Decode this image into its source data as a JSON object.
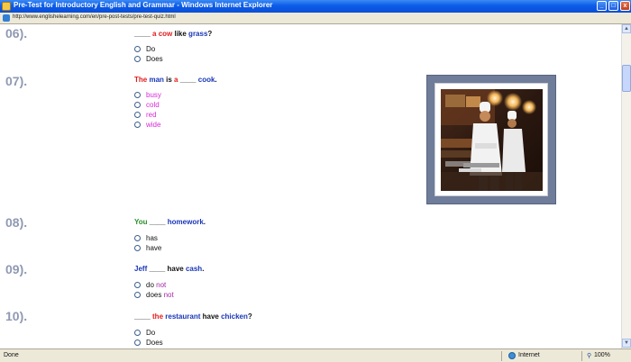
{
  "window": {
    "title": "Pre-Test for Introductory English and Grammar - Windows Internet Explorer",
    "minimize": "_",
    "maximize": "□",
    "close": "x"
  },
  "address": {
    "url": "http://www.englishelearning.com/en/pre-post-tests/pre-test-quiz.html"
  },
  "questions": [
    {
      "number": "06).",
      "parts": [
        {
          "text": "____",
          "color": "blk"
        },
        {
          "text": " a cow",
          "color": "red"
        },
        {
          "text": " like",
          "color": "blk"
        },
        {
          "text": " grass",
          "color": "blu"
        },
        {
          "text": "?",
          "color": "blk"
        }
      ],
      "options": [
        {
          "parts": [
            {
              "text": "Do",
              "color": "blk"
            }
          ]
        },
        {
          "parts": [
            {
              "text": "Does",
              "color": "blk"
            }
          ]
        }
      ]
    },
    {
      "number": "07).",
      "parts": [
        {
          "text": "The",
          "color": "red"
        },
        {
          "text": " man",
          "color": "blu"
        },
        {
          "text": " is",
          "color": "blk"
        },
        {
          "text": " a",
          "color": "red"
        },
        {
          "text": " ____",
          "color": "blk"
        },
        {
          "text": " cook",
          "color": "blu"
        },
        {
          "text": ".",
          "color": "blk"
        }
      ],
      "options": [
        {
          "parts": [
            {
              "text": "busy",
              "color": "mag"
            }
          ]
        },
        {
          "parts": [
            {
              "text": "cold",
              "color": "mag"
            }
          ]
        },
        {
          "parts": [
            {
              "text": "red",
              "color": "mag"
            }
          ]
        },
        {
          "parts": [
            {
              "text": "wide",
              "color": "mag"
            }
          ]
        }
      ]
    },
    {
      "number": "08).",
      "parts": [
        {
          "text": "You",
          "color": "grn"
        },
        {
          "text": " ____",
          "color": "blk"
        },
        {
          "text": " homework",
          "color": "blu"
        },
        {
          "text": ".",
          "color": "blk"
        }
      ],
      "options": [
        {
          "parts": [
            {
              "text": "has",
              "color": "blk"
            }
          ]
        },
        {
          "parts": [
            {
              "text": "have",
              "color": "blk"
            }
          ]
        }
      ]
    },
    {
      "number": "09).",
      "parts": [
        {
          "text": "Jeff",
          "color": "blu"
        },
        {
          "text": " ____ have",
          "color": "blk"
        },
        {
          "text": " cash",
          "color": "blu"
        },
        {
          "text": ".",
          "color": "blk"
        }
      ],
      "options": [
        {
          "parts": [
            {
              "text": "do",
              "color": "blk"
            },
            {
              "text": " not",
              "color": "pur"
            }
          ]
        },
        {
          "parts": [
            {
              "text": "does",
              "color": "blk"
            },
            {
              "text": " not",
              "color": "pur"
            }
          ]
        }
      ]
    },
    {
      "number": "10).",
      "parts": [
        {
          "text": "____",
          "color": "blk"
        },
        {
          "text": " the",
          "color": "red"
        },
        {
          "text": " restaurant",
          "color": "blu"
        },
        {
          "text": " have",
          "color": "blk"
        },
        {
          "text": " chicken",
          "color": "blu"
        },
        {
          "text": "?",
          "color": "blk"
        }
      ],
      "options": [
        {
          "parts": [
            {
              "text": "Do",
              "color": "blk"
            }
          ]
        },
        {
          "parts": [
            {
              "text": "Does",
              "color": "blk"
            }
          ]
        }
      ]
    }
  ],
  "status": {
    "left": "Done",
    "zone": "Internet",
    "zoom": "100%"
  },
  "colors": {
    "title_blue": "#0c5ce8",
    "question_number": "#8f99b3",
    "red": "#e01b1b",
    "blue": "#1936b8",
    "green": "#2a8f2a",
    "magenta": "#d62ad6"
  },
  "icons": {
    "window": "ie-page-icon",
    "address": "page-icon",
    "zone": "globe-icon",
    "zoom": "magnifier-icon"
  }
}
